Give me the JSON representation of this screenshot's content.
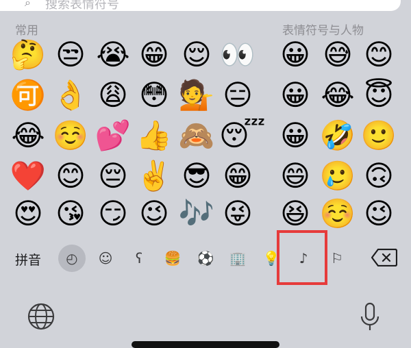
{
  "search": {
    "icon": "search-icon",
    "text": "搜索表情符号"
  },
  "sections": {
    "frequent": "常用",
    "smileys": "表情符号与人物"
  },
  "frequent_emojis": [
    [
      "🤔",
      "😒",
      "😭",
      "😁",
      "😌",
      "👀"
    ],
    [
      "🉑",
      "👌",
      "😩",
      "😳",
      "💁",
      "😑"
    ],
    [
      "😂",
      "☺️",
      "💕",
      "👍",
      "🙈",
      "😴"
    ],
    [
      "❤️",
      "😊",
      "😔",
      "✌️",
      "😎",
      "😁"
    ],
    [
      "😍",
      "😘",
      "😏",
      "😉",
      "🎶",
      "😜"
    ]
  ],
  "smiley_emojis": [
    [
      "😀",
      "😅",
      "😊"
    ],
    [
      "😀",
      "😂",
      "😇"
    ],
    [
      "😀",
      "🤣",
      "🙂"
    ],
    [
      "😄",
      "🥲",
      "🙃"
    ],
    [
      "😆",
      "☺️",
      "😉"
    ]
  ],
  "category_bar": {
    "pinyin_label": "拼音",
    "icons": [
      "clock-icon",
      "smiley-icon",
      "bear-icon",
      "food-icon",
      "soccer-ball-icon",
      "building-icon",
      "lightbulb-icon",
      "symbols-icon",
      "flag-icon"
    ],
    "glyphs": [
      "◴",
      "☺",
      "ʕ",
      "🍔",
      "⚽",
      "🏢",
      "💡",
      "♪",
      "⚐"
    ],
    "active_index": 0,
    "backspace_icon": "backspace-icon"
  },
  "bottom": {
    "globe_icon": "globe-icon",
    "mic_icon": "microphone-icon"
  },
  "colors": {
    "highlight": "#e63b3b",
    "keyboard_bg": "#d1d3d9"
  }
}
